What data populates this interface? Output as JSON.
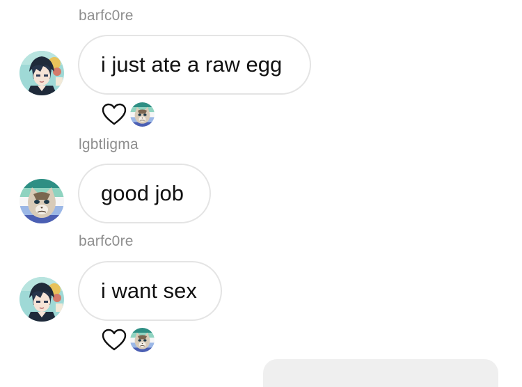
{
  "messages": [
    {
      "username": "barfc0re",
      "avatar": "anime-boy-avatar-icon",
      "text": "i just ate a raw egg",
      "reactions": {
        "liked": true,
        "reactor_avatar": "grumpy-cat-avatar-icon"
      }
    },
    {
      "username": "lgbtligma",
      "avatar": "grumpy-cat-avatar-icon",
      "text": "good job",
      "reactions": null
    },
    {
      "username": "barfc0re",
      "avatar": "anime-boy-avatar-icon",
      "text": "i want sex",
      "reactions": {
        "liked": true,
        "reactor_avatar": "grumpy-cat-avatar-icon"
      }
    }
  ],
  "colors": {
    "username": "#8e8e8e",
    "bubble_border": "#e4e4e4",
    "message_text": "#111111",
    "outgoing_bubble": "#efefef"
  }
}
